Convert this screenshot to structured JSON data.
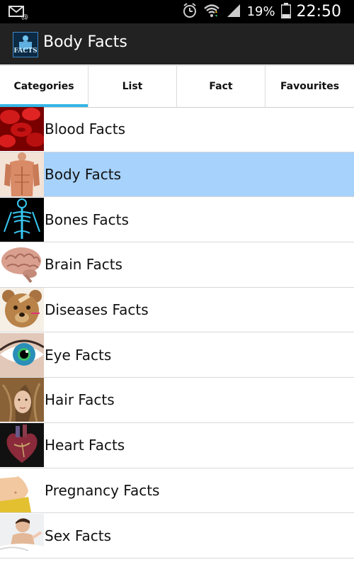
{
  "status_bar": {
    "battery_percent": "19%",
    "time": "22:50",
    "icons": [
      "mail-notification-icon",
      "alarm-icon",
      "wifi-icon",
      "signal-icon",
      "battery-icon"
    ]
  },
  "action_bar": {
    "app_icon_text": "FACTS",
    "title": "Body Facts"
  },
  "tabs": [
    {
      "label": "Categories",
      "active": true
    },
    {
      "label": "List",
      "active": false
    },
    {
      "label": "Fact",
      "active": false
    },
    {
      "label": "Favourites",
      "active": false
    }
  ],
  "list": {
    "items": [
      {
        "label": "Blood Facts",
        "icon": "blood-cells-thumbnail",
        "selected": false
      },
      {
        "label": "Body Facts",
        "icon": "torso-thumbnail",
        "selected": true
      },
      {
        "label": "Bones Facts",
        "icon": "skeleton-thumbnail",
        "selected": false
      },
      {
        "label": "Brain Facts",
        "icon": "brain-thumbnail",
        "selected": false
      },
      {
        "label": "Diseases Facts",
        "icon": "teddy-bear-thumbnail",
        "selected": false
      },
      {
        "label": "Eye Facts",
        "icon": "eye-thumbnail",
        "selected": false
      },
      {
        "label": "Hair Facts",
        "icon": "hair-thumbnail",
        "selected": false
      },
      {
        "label": "Heart Facts",
        "icon": "heart-thumbnail",
        "selected": false
      },
      {
        "label": "Pregnancy Facts",
        "icon": "pregnancy-thumbnail",
        "selected": false
      },
      {
        "label": "Sex Facts",
        "icon": "couple-thumbnail",
        "selected": false
      }
    ]
  },
  "colors": {
    "accent": "#33b5e5",
    "selected_row": "#a7d2fb",
    "action_bar": "#222222",
    "status_bar": "#000000"
  }
}
